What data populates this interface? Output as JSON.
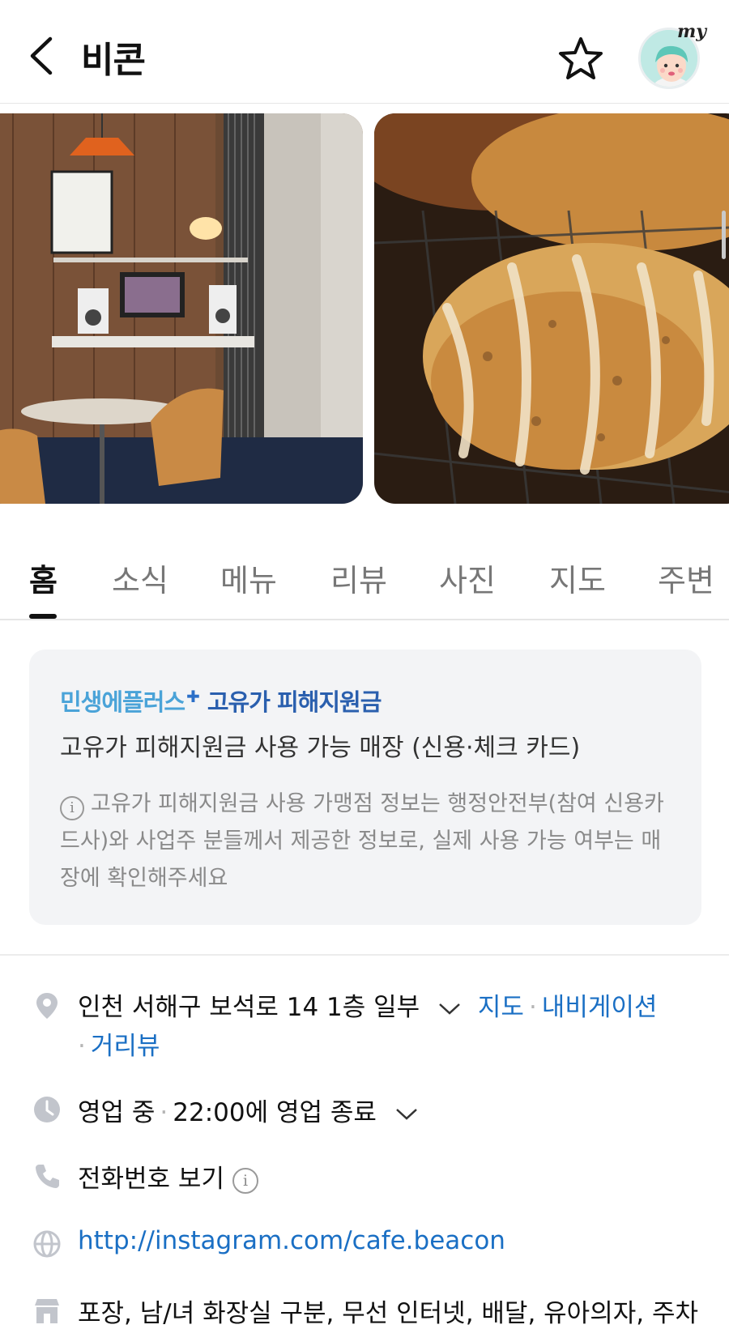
{
  "header": {
    "title": "비콘",
    "back_icon": "chevron-left-icon",
    "favorite_icon": "star-icon",
    "profile_badge": "my"
  },
  "photos": [
    {
      "icon": "cafe-interior-photo"
    },
    {
      "icon": "scone-pastry-photo"
    }
  ],
  "tabs": [
    {
      "label": "홈",
      "active": true
    },
    {
      "label": "소식"
    },
    {
      "label": "메뉴"
    },
    {
      "label": "리뷰"
    },
    {
      "label": "사진"
    },
    {
      "label": "지도"
    },
    {
      "label": "주변"
    }
  ],
  "support_card": {
    "brand_part1": "민생에플러스",
    "brand_part2": "고유가 피해지원금",
    "subtitle": "고유가 피해지원금 사용 가능 매장 (신용·체크 카드)",
    "notice": "고유가 피해지원금 사용 가맹점 정보는 행정안전부(참여 신용카드사)와 사업주 분들께서 제공한 정보로, 실제 사용 가능 여부는 매장에 확인해주세요"
  },
  "info": {
    "address": "인천 서해구 보석로 14 1층 일부",
    "address_links": [
      "지도",
      "내비게이션",
      "거리뷰"
    ],
    "status": "영업 중",
    "hours": "22:00에 영업 종료",
    "phone": "전화번호 보기",
    "website": "http://instagram.com/cafe.beacon",
    "amenities": "포장, 남/녀 화장실 구분, 무선 인터넷, 배달, 유아의자, 주차"
  },
  "colors": {
    "link": "#1a6fc4",
    "brand_light": "#4aa3d8",
    "brand_dark": "#2a5fae",
    "card_bg": "#f3f4f6",
    "icon_gray": "#c2c5cc"
  }
}
